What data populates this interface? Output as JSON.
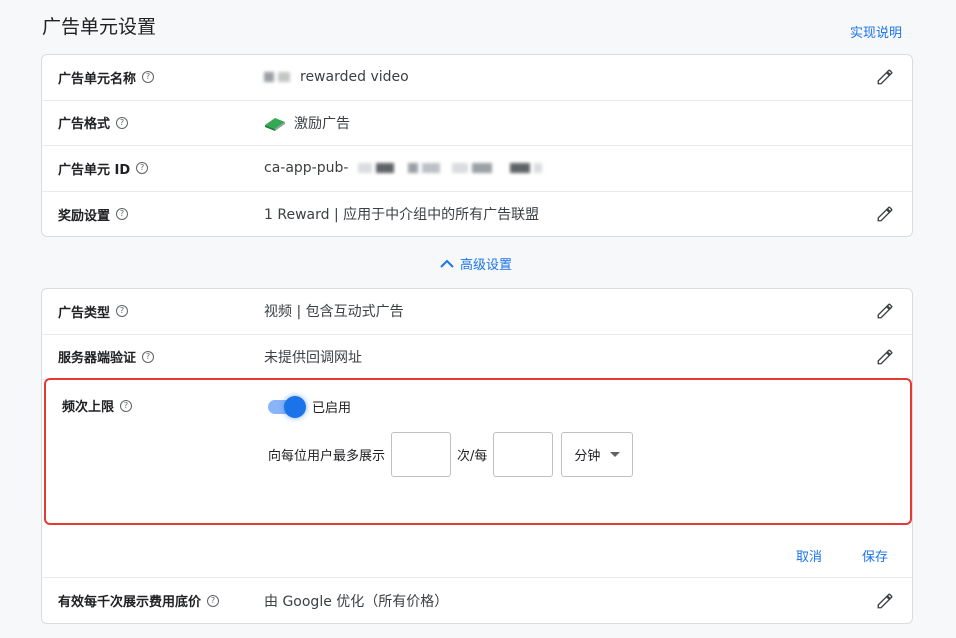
{
  "header": {
    "title": "广告单元设置",
    "help_link": "实现说明"
  },
  "basic": {
    "ad_unit_name": {
      "label": "广告单元名称",
      "value_suffix": "rewarded video"
    },
    "ad_format": {
      "label": "广告格式",
      "value": "激励广告",
      "icon": "reward-book-icon"
    },
    "ad_unit_id": {
      "label": "广告单元 ID",
      "value_prefix": "ca-app-pub-"
    },
    "reward": {
      "label": "奖励设置",
      "value": "1 Reward | 应用于中介组中的所有广告联盟"
    }
  },
  "advanced_toggle": {
    "label": "高级设置"
  },
  "advanced": {
    "ad_type": {
      "label": "广告类型",
      "value": "视频 | 包含互动式广告"
    },
    "ssv": {
      "label": "服务器端验证",
      "value": "未提供回调网址"
    },
    "frequency_cap": {
      "label": "频次上限",
      "toggle_label": "已启用",
      "enabled": true,
      "prefix": "向每位用户最多展示",
      "middle": "次/每",
      "impressions_value": "",
      "period_value": "",
      "unit_selected": "分钟"
    },
    "cancel": "取消",
    "save": "保存",
    "ecpm_floor": {
      "label": "有效每千次展示费用底价",
      "value": "由 Google 优化（所有价格）"
    }
  },
  "colors": {
    "accent": "#1a73e8",
    "highlight_border": "#e53935"
  }
}
